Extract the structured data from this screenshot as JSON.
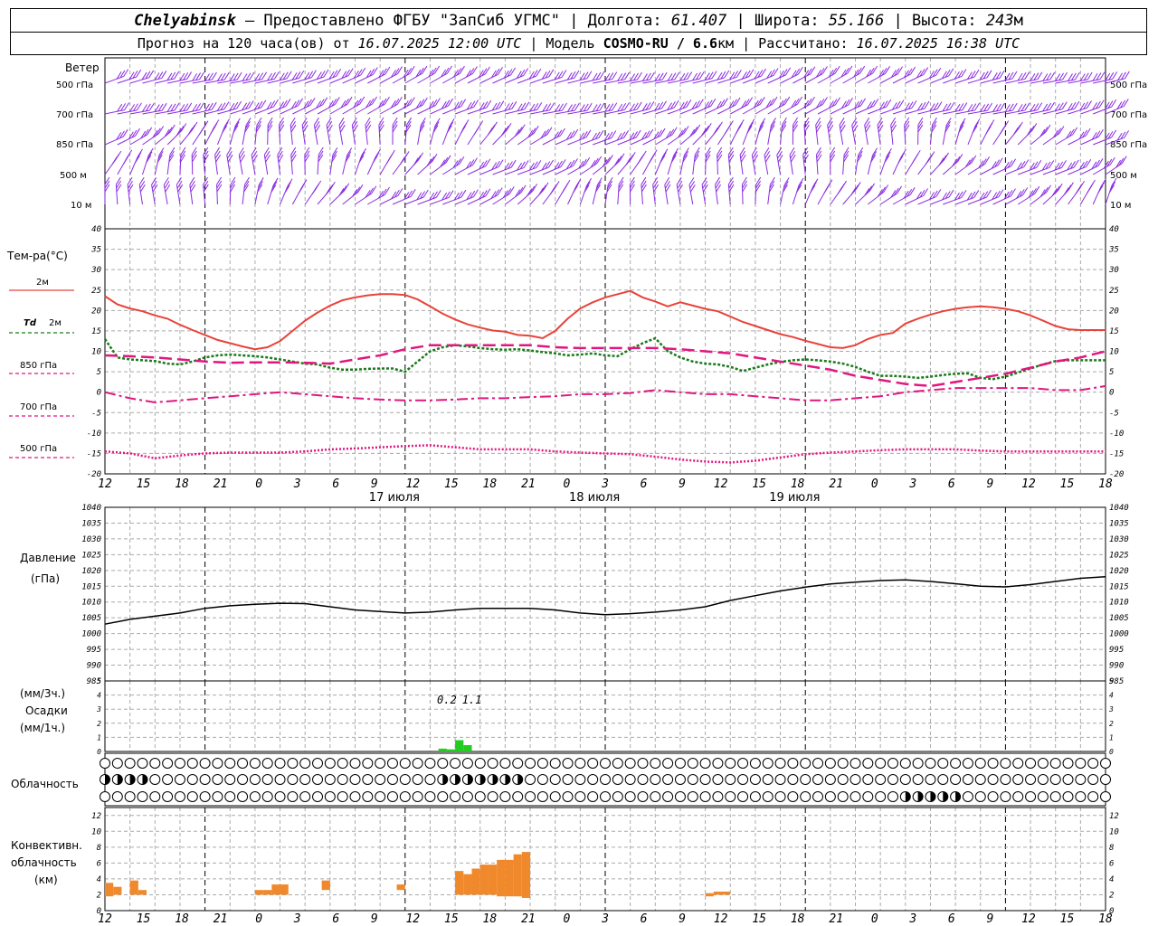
{
  "header": {
    "station": "Chelyabinsk",
    "provider": "– Предоставлено ФГБУ \"ЗапСиб УГМС\"",
    "lon_label": "| Долгота:",
    "lon": "61.407",
    "lat_label": "| Широта:",
    "lat": "55.166",
    "alt_label": "| Высота:",
    "alt": "243",
    "alt_unit": "м",
    "forecast_label": "Прогноз на 120 часа(ов) от",
    "forecast_from": "16.07.2025 12:00 UTC",
    "model_label": "| Модель",
    "model": "COSMO-RU / 6.6",
    "model_unit": "км",
    "calc_label": "| Рассчитано:",
    "calc_time": "16.07.2025 16:38 UTC"
  },
  "wind_panel": {
    "title": "Ветер",
    "levels": [
      "500 гПа",
      "700 гПа",
      "850 гПа",
      "500 м",
      "10  м"
    ],
    "color": "#8a2be2"
  },
  "temp_panel": {
    "title": "Тем-ра(°С)",
    "legend": [
      {
        "label": "2м",
        "color": "#e8433a",
        "style": "solid"
      },
      {
        "label": "Td",
        "label2": "2м",
        "color": "#1a7a1a",
        "style": "dotted"
      },
      {
        "label": "850 гПа",
        "color": "#e0177f",
        "style": "dashed"
      },
      {
        "label": "700 гПа",
        "color": "#e0177f",
        "style": "dashdot"
      },
      {
        "label": "500 гПа",
        "color": "#e0177f",
        "style": "dots"
      }
    ]
  },
  "pressure_panel": {
    "title": "Давление",
    "unit": "(гПа)"
  },
  "precip_panel": {
    "unit_top": "(мм/3ч.)",
    "title": "Осадки",
    "unit_bottom": "(мм/1ч.)",
    "annotations": [
      {
        "x": 41,
        "text": "0.2"
      },
      {
        "x": 44,
        "text": "1.1"
      }
    ]
  },
  "cloud_panel": {
    "title": "Облачность"
  },
  "convective_panel": {
    "title": [
      "Конвективн.",
      "облачность",
      "(км)"
    ]
  },
  "x_axis": {
    "tick_labels": [
      "12",
      "15",
      "18",
      "21",
      "0",
      "3",
      "6",
      "9",
      "12",
      "15",
      "18",
      "21",
      "0",
      "3",
      "6",
      "9",
      "12",
      "15",
      "18",
      "21",
      "0",
      "3",
      "6",
      "9",
      "12",
      "15",
      "18"
    ],
    "date_labels": [
      "17 июля",
      "18 июля",
      "19 июля"
    ],
    "day_starts_hours": [
      12,
      36,
      60,
      84,
      108
    ]
  },
  "chart_data": [
    {
      "type": "line",
      "title": "Тем-ра(°С)",
      "x_unit": "hours since forecast start (16.07 12 UTC)",
      "ylim": [
        -20,
        40
      ],
      "yticks": [
        40,
        35,
        30,
        25,
        20,
        15,
        10,
        5,
        0,
        -5,
        -10,
        -15,
        -20
      ],
      "series": [
        {
          "name": "2м",
          "x": [
            0,
            1.5,
            3,
            4.5,
            6,
            7.5,
            9,
            10.5,
            12,
            13.5,
            15,
            16.5,
            18,
            19.5,
            21,
            22.5,
            24,
            25.5,
            27,
            28.5,
            30,
            31.5,
            33,
            34.5,
            36,
            37.5,
            39,
            40.5,
            42,
            43.5,
            45,
            46.5,
            48,
            49.5,
            51,
            52.5,
            54,
            55.5,
            57,
            58.5,
            60,
            61.5,
            63,
            64.5,
            66,
            67.5,
            69,
            70.5,
            72,
            73.5,
            75,
            76.5,
            78,
            79.5,
            81,
            82.5,
            84,
            85.5,
            87,
            88.5,
            90,
            91.5,
            93,
            94.5,
            96,
            97.5,
            99,
            100.5,
            102,
            103.5,
            105,
            106.5,
            108,
            109.5,
            111,
            112.5,
            114,
            115.5,
            117,
            118.5,
            120
          ],
          "values": [
            23.5,
            21.5,
            20.5,
            19.8,
            18.8,
            18,
            16.5,
            15.2,
            14,
            12.8,
            12,
            11.2,
            10.5,
            11,
            12.5,
            15,
            17.5,
            19.5,
            21.2,
            22.5,
            23.2,
            23.7,
            24,
            24,
            23.8,
            22.7,
            21,
            19.2,
            17.8,
            16.6,
            15.8,
            15.1,
            14.8,
            14,
            13.8,
            13.2,
            15,
            18,
            20.5,
            22,
            23.2,
            24,
            24.8,
            23.2,
            22.2,
            21,
            22,
            21.2,
            20.4,
            19.8,
            18.5,
            17.2,
            16.2,
            15.2,
            14.2,
            13.5,
            12.6,
            11.8,
            11,
            10.8,
            11.5,
            13,
            14,
            14.5,
            16.8,
            18,
            19,
            19.8,
            20.4,
            20.8,
            21,
            20.8,
            20.4,
            19.8,
            18.8,
            17.5,
            16.2,
            15.4,
            15.2,
            15.2,
            15.2
          ]
        },
        {
          "name": "Td 2м",
          "x": [
            0,
            1.5,
            3,
            4.5,
            6,
            7.5,
            9,
            10.5,
            12,
            13.5,
            15,
            16.5,
            18,
            19.5,
            21,
            22.5,
            24,
            25.5,
            27,
            28.5,
            30,
            31.5,
            33,
            34.5,
            36,
            37.5,
            39,
            40.5,
            42,
            43.5,
            45,
            46.5,
            48,
            49.5,
            51,
            52.5,
            54,
            55.5,
            57,
            58.5,
            60,
            61.5,
            63,
            64.5,
            66,
            67.5,
            69,
            70.5,
            72,
            73.5,
            75,
            76.5,
            78,
            79.5,
            81,
            82.5,
            84,
            85.5,
            87,
            88.5,
            90,
            91.5,
            93,
            94.5,
            96,
            97.5,
            99,
            100.5,
            102,
            103.5,
            105,
            106.5,
            108,
            109.5,
            111,
            112.5,
            114,
            115.5,
            117,
            118.5,
            120
          ],
          "values": [
            13,
            8.5,
            8,
            7.8,
            7.6,
            7,
            6.8,
            7.5,
            8.5,
            9,
            9.2,
            9,
            8.8,
            8.5,
            8,
            7.5,
            7,
            6.8,
            6,
            5.5,
            5.5,
            5.7,
            5.8,
            5.8,
            5,
            7.5,
            10,
            11,
            11.5,
            11.2,
            10.8,
            10.5,
            10.4,
            10.5,
            10.2,
            9.8,
            9.5,
            9,
            9.2,
            9.5,
            9,
            8.8,
            10.5,
            12,
            13.2,
            10,
            8.5,
            7.5,
            7,
            6.8,
            6.2,
            5.2,
            6,
            6.8,
            7.4,
            7.8,
            8,
            7.8,
            7.5,
            7,
            6.2,
            5,
            4,
            4,
            3.8,
            3.5,
            3.8,
            4.2,
            4.5,
            4.6,
            3.5,
            3.2,
            3.8,
            4.8,
            5.8,
            6.8,
            7.6,
            7.8,
            7.8,
            7.8,
            7.8
          ]
        },
        {
          "name": "850 гПа",
          "x": [
            0,
            3,
            6,
            9,
            12,
            15,
            18,
            21,
            24,
            27,
            30,
            33,
            36,
            39,
            42,
            45,
            48,
            51,
            54,
            57,
            60,
            63,
            66,
            69,
            72,
            75,
            78,
            81,
            84,
            87,
            90,
            93,
            96,
            99,
            102,
            105,
            108,
            111,
            114,
            117,
            120
          ],
          "values": [
            9,
            8.8,
            8.5,
            8,
            7.5,
            7.2,
            7.3,
            7.3,
            7.2,
            7,
            8,
            9,
            10.5,
            11.5,
            11.5,
            11.5,
            11.5,
            11.5,
            11,
            10.8,
            10.8,
            10.8,
            10.8,
            10.5,
            10,
            9.5,
            8.5,
            7.5,
            6.5,
            5.5,
            4,
            3,
            2,
            1.5,
            2.5,
            3.5,
            4.5,
            6,
            7.5,
            8.5,
            10
          ]
        },
        {
          "name": "700 гПа",
          "x": [
            0,
            3,
            6,
            9,
            12,
            15,
            18,
            21,
            24,
            27,
            30,
            33,
            36,
            39,
            42,
            45,
            48,
            51,
            54,
            57,
            60,
            63,
            66,
            69,
            72,
            75,
            78,
            81,
            84,
            87,
            90,
            93,
            96,
            99,
            102,
            105,
            108,
            111,
            114,
            117,
            120
          ],
          "values": [
            0,
            -1.5,
            -2.5,
            -2,
            -1.5,
            -1,
            -0.5,
            0,
            -0.5,
            -1,
            -1.5,
            -1.8,
            -2,
            -2,
            -1.8,
            -1.5,
            -1.5,
            -1.2,
            -1,
            -0.5,
            -0.5,
            -0.2,
            0.5,
            0,
            -0.5,
            -0.5,
            -1,
            -1.5,
            -2,
            -2,
            -1.5,
            -1,
            0,
            0.5,
            1,
            1,
            1,
            1,
            0.5,
            0.5,
            1.5
          ]
        },
        {
          "name": "500 гПа",
          "x": [
            0,
            3,
            6,
            9,
            12,
            15,
            18,
            21,
            24,
            27,
            30,
            33,
            36,
            39,
            42,
            45,
            48,
            51,
            54,
            57,
            60,
            63,
            66,
            69,
            72,
            75,
            78,
            81,
            84,
            87,
            90,
            93,
            96,
            99,
            102,
            105,
            108,
            111,
            114,
            117,
            120
          ],
          "values": [
            -14.5,
            -15,
            -16.2,
            -15.5,
            -15,
            -14.8,
            -14.8,
            -14.8,
            -14.5,
            -14,
            -13.8,
            -13.5,
            -13.2,
            -13,
            -13.5,
            -14,
            -14,
            -14,
            -14.5,
            -14.8,
            -15,
            -15.2,
            -15.8,
            -16.5,
            -17,
            -17.2,
            -16.8,
            -16,
            -15.2,
            -14.8,
            -14.5,
            -14.2,
            -14,
            -14,
            -14,
            -14.3,
            -14.5,
            -14.5,
            -14.5,
            -14.5,
            -14.5
          ]
        }
      ]
    },
    {
      "type": "line",
      "title": "Давление",
      "ylabel": "(гПа)",
      "ylim": [
        985,
        1040
      ],
      "yticks": [
        1040,
        1035,
        1030,
        1025,
        1020,
        1015,
        1010,
        1005,
        1000,
        995,
        990,
        985
      ],
      "series": [
        {
          "name": "Давление",
          "x": [
            0,
            3,
            6,
            9,
            12,
            15,
            18,
            21,
            24,
            27,
            30,
            33,
            36,
            39,
            42,
            45,
            48,
            51,
            54,
            57,
            60,
            63,
            66,
            69,
            72,
            75,
            78,
            81,
            84,
            87,
            90,
            93,
            96,
            99,
            102,
            105,
            108,
            111,
            114,
            117,
            120
          ],
          "values": [
            1003,
            1004.5,
            1005.5,
            1006.5,
            1008,
            1008.8,
            1009.3,
            1009.6,
            1009.5,
            1008.5,
            1007.5,
            1007,
            1006.5,
            1006.8,
            1007.5,
            1008,
            1008,
            1008,
            1007.5,
            1006.5,
            1006,
            1006.3,
            1006.8,
            1007.5,
            1008.5,
            1010.5,
            1012,
            1013.5,
            1014.7,
            1015.7,
            1016.3,
            1016.8,
            1017,
            1016.5,
            1015.8,
            1015,
            1014.8,
            1015.5,
            1016.5,
            1017.5,
            1018
          ]
        }
      ]
    },
    {
      "type": "bar",
      "title": "Осадки",
      "ylim": [
        0,
        5
      ],
      "yticks": [
        0,
        1,
        2,
        3,
        4,
        5
      ],
      "x_unit": "hours since forecast start",
      "x": [
        40,
        41,
        42,
        43
      ],
      "values": [
        0.2,
        0.15,
        0.8,
        0.45
      ]
    },
    {
      "type": "bar",
      "title": "Конвективн. облачность (км)",
      "ylim": [
        0,
        13
      ],
      "yticks": [
        0,
        2,
        4,
        6,
        8,
        10,
        12
      ],
      "x_unit": "hours since forecast start",
      "bars": [
        {
          "x": 0.5,
          "bottom": 1.8,
          "top": 3.5
        },
        {
          "x": 1.5,
          "bottom": 2.0,
          "top": 3.0
        },
        {
          "x": 3.5,
          "bottom": 2.0,
          "top": 3.8
        },
        {
          "x": 4.5,
          "bottom": 2.0,
          "top": 2.6
        },
        {
          "x": 18.5,
          "bottom": 2.0,
          "top": 2.6
        },
        {
          "x": 19.5,
          "bottom": 2.0,
          "top": 2.6
        },
        {
          "x": 20.5,
          "bottom": 2.0,
          "top": 3.3
        },
        {
          "x": 21.5,
          "bottom": 2.0,
          "top": 3.3
        },
        {
          "x": 26.5,
          "bottom": 2.6,
          "top": 3.8
        },
        {
          "x": 35.5,
          "bottom": 2.6,
          "top": 3.3
        },
        {
          "x": 42.5,
          "bottom": 2.0,
          "top": 5.0
        },
        {
          "x": 43.5,
          "bottom": 2.0,
          "top": 4.6
        },
        {
          "x": 44.5,
          "bottom": 2.0,
          "top": 5.3
        },
        {
          "x": 45.5,
          "bottom": 2.0,
          "top": 5.8
        },
        {
          "x": 46.5,
          "bottom": 2.0,
          "top": 5.8
        },
        {
          "x": 47.5,
          "bottom": 1.8,
          "top": 6.4
        },
        {
          "x": 48.5,
          "bottom": 1.8,
          "top": 6.4
        },
        {
          "x": 49.5,
          "bottom": 1.8,
          "top": 7.1
        },
        {
          "x": 50.5,
          "bottom": 1.6,
          "top": 7.4
        },
        {
          "x": 72.5,
          "bottom": 1.8,
          "top": 2.2
        },
        {
          "x": 73.5,
          "bottom": 2.0,
          "top": 2.4
        },
        {
          "x": 74.5,
          "bottom": 2.0,
          "top": 2.4
        }
      ]
    }
  ]
}
